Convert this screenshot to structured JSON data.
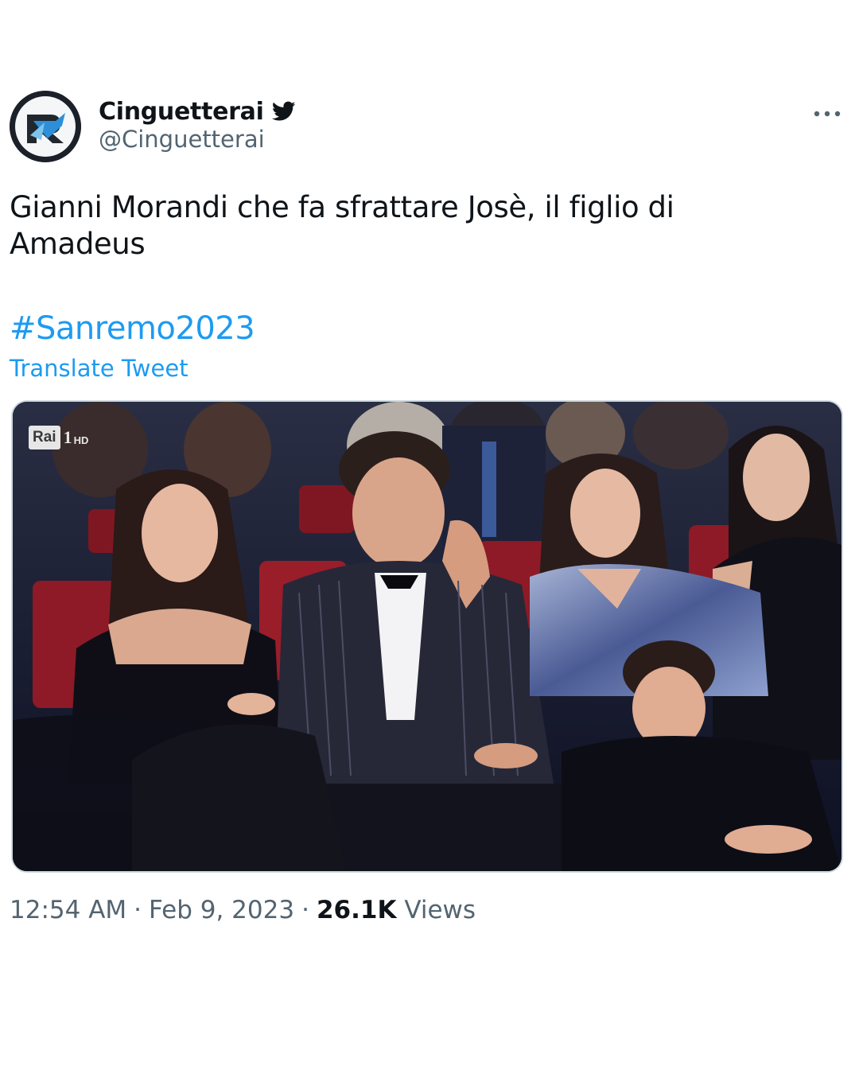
{
  "author": {
    "display_name": "Cinguetterai",
    "handle": "@Cinguetterai",
    "verified": true,
    "avatar_icon": "cinguetterai-logo"
  },
  "tweet": {
    "text_line1": "Gianni Morandi che fa sfrattare Josè, il figlio di",
    "text_line2": "Amadeus",
    "hashtag": "#Sanremo2023",
    "translate_label": "Translate Tweet"
  },
  "media": {
    "type": "video-still",
    "broadcaster_logo": "Rai",
    "channel_number": "1",
    "channel_quality": "HD"
  },
  "meta": {
    "time": "12:54 AM",
    "separator": "·",
    "date": "Feb 9, 2023",
    "views_count": "26.1K",
    "views_label": "Views"
  },
  "colors": {
    "link": "#1d9bf0",
    "text": "#0f1419",
    "secondary": "#536471",
    "border": "#cfd9de"
  }
}
